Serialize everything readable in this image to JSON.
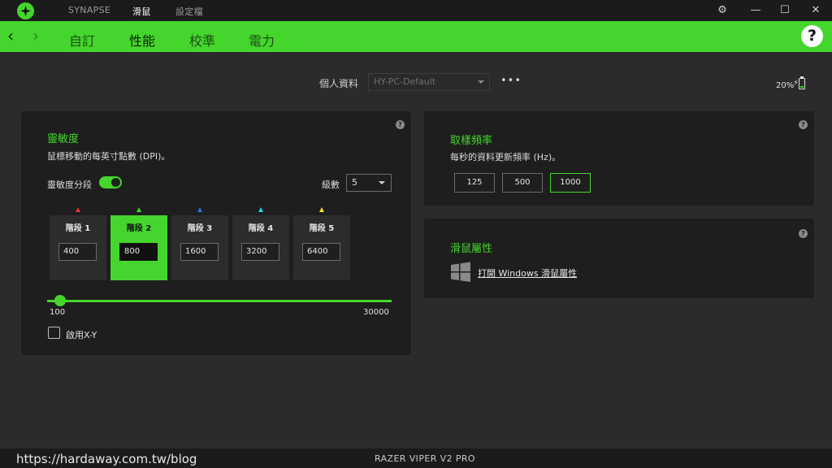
{
  "titlebar": {
    "tabs": [
      {
        "label": "SYNAPSE",
        "active": false
      },
      {
        "label": "滑鼠",
        "active": true
      },
      {
        "label": "設定檔",
        "active": false
      }
    ]
  },
  "nav": {
    "tabs": [
      {
        "label": "自訂",
        "active": false
      },
      {
        "label": "性能",
        "active": true
      },
      {
        "label": "校準",
        "active": false
      },
      {
        "label": "電力",
        "active": false
      }
    ],
    "help": "?"
  },
  "profile": {
    "label": "個人資料",
    "value": "HY-PC-Default",
    "more": "•••"
  },
  "battery": {
    "percent_label": "20%",
    "level": 0.2
  },
  "sensitivity": {
    "title": "靈敏度",
    "description": "鼠標移動的每英寸點數 (DPI)。",
    "stages_toggle_label": "靈敏度分段",
    "stages_enabled": true,
    "levels_label": "級數",
    "levels_value": "5",
    "stages": [
      {
        "label": "階段 1",
        "dpi": "400",
        "active": false,
        "color": "#e53935"
      },
      {
        "label": "階段 2",
        "dpi": "800",
        "active": true,
        "color": "#44d62c"
      },
      {
        "label": "階段 3",
        "dpi": "1600",
        "active": false,
        "color": "#2f6fe0"
      },
      {
        "label": "階段 4",
        "dpi": "3200",
        "active": false,
        "color": "#22d3e6"
      },
      {
        "label": "階段 5",
        "dpi": "6400",
        "active": false,
        "color": "#f2e522"
      }
    ],
    "slider": {
      "min": "100",
      "max": "30000"
    },
    "xy_label": "啟用X-Y",
    "xy_enabled": false
  },
  "polling": {
    "title": "取樣頻率",
    "description": "每秒的資料更新頻率 (Hz)。",
    "rates": [
      {
        "label": "125",
        "active": false
      },
      {
        "label": "500",
        "active": false
      },
      {
        "label": "1000",
        "active": true
      }
    ]
  },
  "mouse_props": {
    "title": "滑鼠屬性",
    "link": "打開 Windows 滑鼠屬性"
  },
  "footer": {
    "watermark": "https://hardaway.com.tw/blog",
    "device": "RAZER VIPER V2 PRO"
  },
  "colors": {
    "accent": "#44d62c",
    "panel": "#1e1e1e",
    "background": "#2b2b2b"
  }
}
